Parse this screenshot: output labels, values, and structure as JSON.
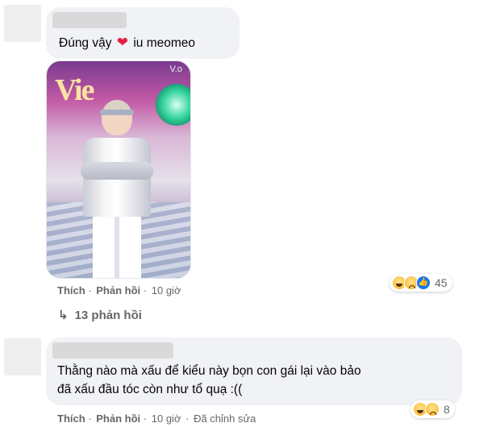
{
  "comment1": {
    "text_before": "Đúng vậy",
    "heart": "❤",
    "text_after": "iu meomeo",
    "photo_logo": "Vie",
    "photo_logo_small": "V.o",
    "actions": {
      "like": "Thích",
      "reply": "Phản hồi",
      "time": "10 giờ"
    },
    "reactions": {
      "icons": [
        "haha-icon",
        "sad-icon",
        "like-icon"
      ],
      "count": "45"
    },
    "replies_link": "13 phản hồi"
  },
  "comment2": {
    "line1": "Thằng nào mà xấu để kiểu này bọn con gái lại vào bảo",
    "line2": "đã xấu đầu tóc còn như tổ quạ :((",
    "actions": {
      "like": "Thích",
      "reply": "Phản hồi",
      "time": "10 giờ",
      "edited": "Đã chỉnh sửa"
    },
    "reactions": {
      "icons": [
        "haha-icon",
        "sad-icon"
      ],
      "count": "8"
    }
  },
  "separator": "·",
  "colors": {
    "bubble": "#f0f2f5",
    "meta": "#65676b",
    "heart": "#e41e3f",
    "like": "#1877f2"
  }
}
